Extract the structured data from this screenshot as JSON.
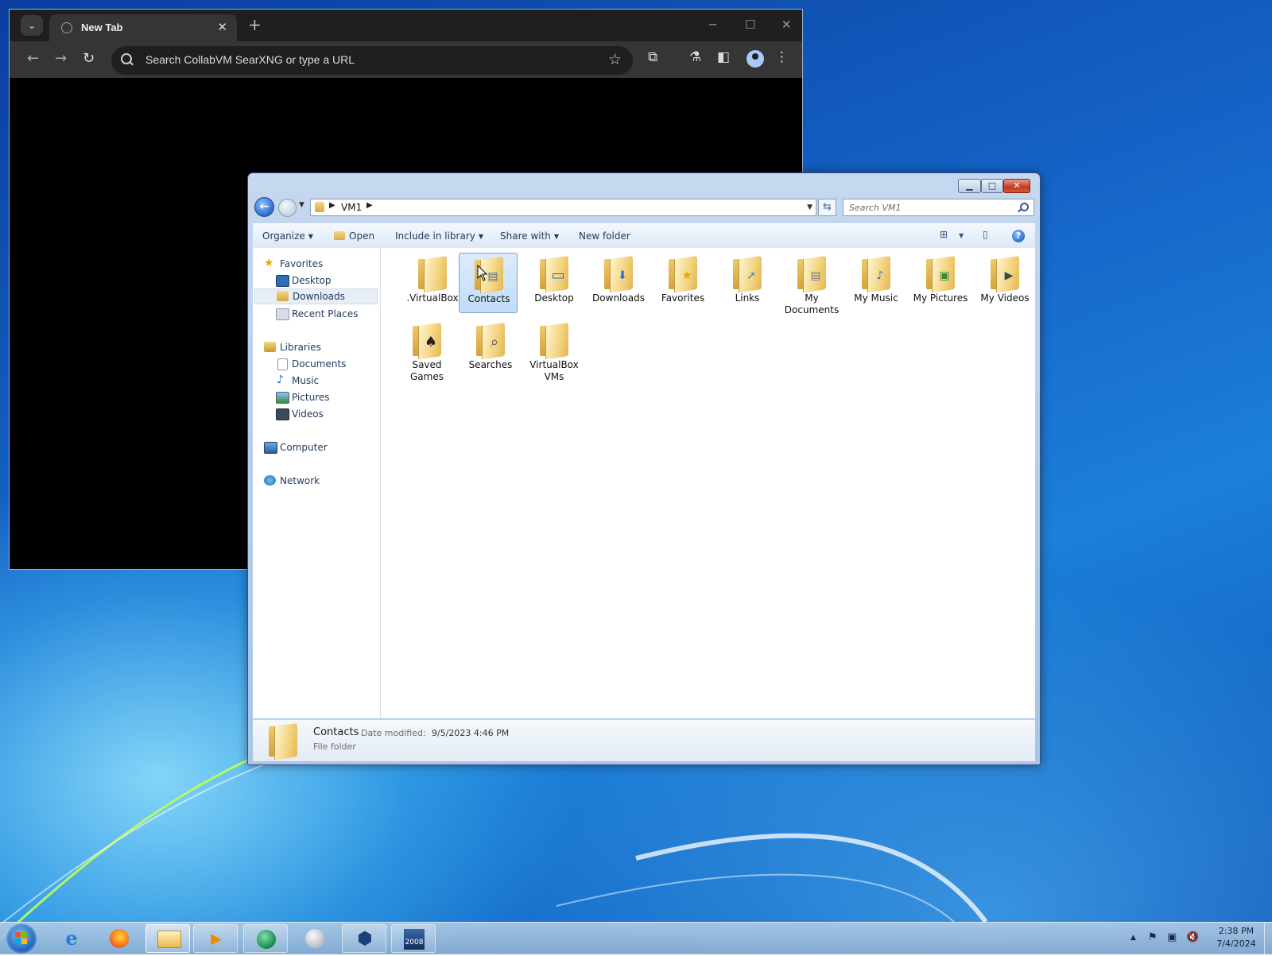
{
  "browser": {
    "tab_title": "New Tab",
    "tab_close": "✕",
    "new_tab": "+",
    "omnibox_placeholder": "Search CollabVM SearXNG or type a URL",
    "minimize": "─",
    "maximize": "☐",
    "close": "✕",
    "back": "←",
    "forward": "→",
    "reload": "↻",
    "bookmark_star": "☆",
    "extensions": "⧉",
    "labs": "⚗",
    "side_panel": "◧",
    "menu": "⋮",
    "tab_list": "⌄"
  },
  "explorer": {
    "breadcrumb": "VM1",
    "search_placeholder": "Search VM1",
    "commands": {
      "organize": "Organize",
      "open": "Open",
      "include_in_library": "Include in library",
      "share_with": "Share with",
      "new_folder": "New folder"
    },
    "window_buttons": {
      "minimize": "▁",
      "maximize": "□",
      "close": "✕"
    },
    "help": "?",
    "view_toggle": "⊞",
    "preview_pane": "▯",
    "nav": {
      "favorites": "Favorites",
      "desktop": "Desktop",
      "downloads": "Downloads",
      "recent_places": "Recent Places",
      "libraries": "Libraries",
      "documents": "Documents",
      "music": "Music",
      "pictures": "Pictures",
      "videos": "Videos",
      "computer": "Computer",
      "network": "Network"
    },
    "items": [
      {
        "label": ".VirtualBox",
        "badge": ""
      },
      {
        "label": "Contacts",
        "badge": "▤"
      },
      {
        "label": "Desktop",
        "badge": "▭"
      },
      {
        "label": "Downloads",
        "badge": "⬇"
      },
      {
        "label": "Favorites",
        "badge": "★"
      },
      {
        "label": "Links",
        "badge": "➚"
      },
      {
        "label": "My Documents",
        "badge": "▤"
      },
      {
        "label": "My Music",
        "badge": "♪"
      },
      {
        "label": "My Pictures",
        "badge": "▣"
      },
      {
        "label": "My Videos",
        "badge": "▶"
      },
      {
        "label": "Saved Games",
        "badge": "♠"
      },
      {
        "label": "Searches",
        "badge": "⌕"
      },
      {
        "label": "VirtualBox VMs",
        "badge": ""
      }
    ],
    "selected_item": "Contacts",
    "details": {
      "name": "Contacts",
      "date_label": "Date modified:",
      "date_value": "9/5/2023 4:46 PM",
      "type": "File folder"
    }
  },
  "taskbar": {
    "clock_time": "2:38 PM",
    "clock_date": "7/4/2024",
    "apps": [
      "internet-explorer",
      "firefox",
      "windows-explorer",
      "media-player",
      "collabvm-client",
      "unknown-app",
      "virtualbox",
      "server-2008"
    ],
    "server_badge": "2008",
    "tray_expand": "▲"
  },
  "colors": {
    "desktop_blue": "#1563c7",
    "taskbar": "#a7c1dd",
    "explorer_frame": "#b9cfeb",
    "chrome_dark": "#1f1f1f",
    "selection": "#cce4fb"
  }
}
